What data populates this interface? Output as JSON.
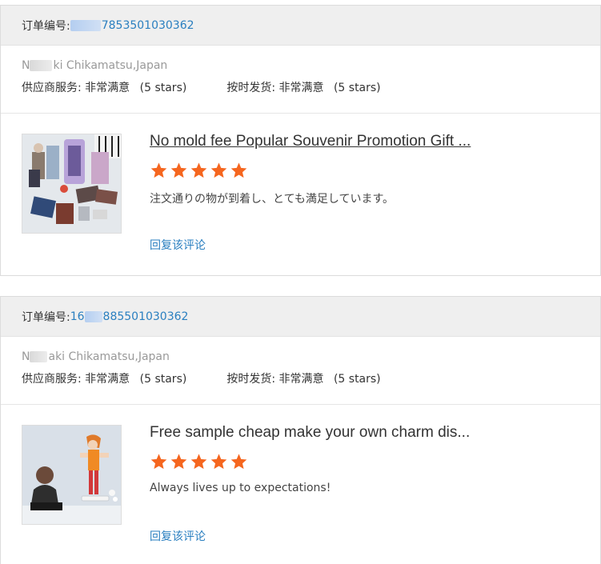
{
  "reviews": [
    {
      "order_label": "订单编号:",
      "order_number_visible": "7853501030362",
      "buyer_visible": "ki Chikamatsu,Japan",
      "buyer_prefix_visible": "N",
      "supplier_service_label": "供应商服务:",
      "supplier_service_value": "非常满意",
      "supplier_service_stars": "(5 stars)",
      "on_time_label": "按时发货:",
      "on_time_value": "非常满意",
      "on_time_stars": "(5 stars)",
      "product_title": "No mold fee Popular Souvenir Promotion Gift ...",
      "star_count": 5,
      "review_text": "注文通りの物が到着し、とても満足しています。",
      "reply_label": "回复该评论"
    },
    {
      "order_label": "订单编号:",
      "order_number_prefix_visible": "16",
      "order_number_visible": "885501030362",
      "buyer_prefix_visible": "N",
      "buyer_visible": "aki Chikamatsu,Japan",
      "supplier_service_label": "供应商服务:",
      "supplier_service_value": "非常满意",
      "supplier_service_stars": "(5 stars)",
      "on_time_label": "按时发货:",
      "on_time_value": "非常满意",
      "on_time_stars": "(5 stars)",
      "product_title": "Free sample cheap make your own charm dis...",
      "star_count": 5,
      "review_text": "Always lives up to expectations!",
      "reply_label": "回复该评论"
    }
  ],
  "colors": {
    "star": "#f5661f",
    "link": "#2a7fc0",
    "header_bg": "#efefef"
  }
}
